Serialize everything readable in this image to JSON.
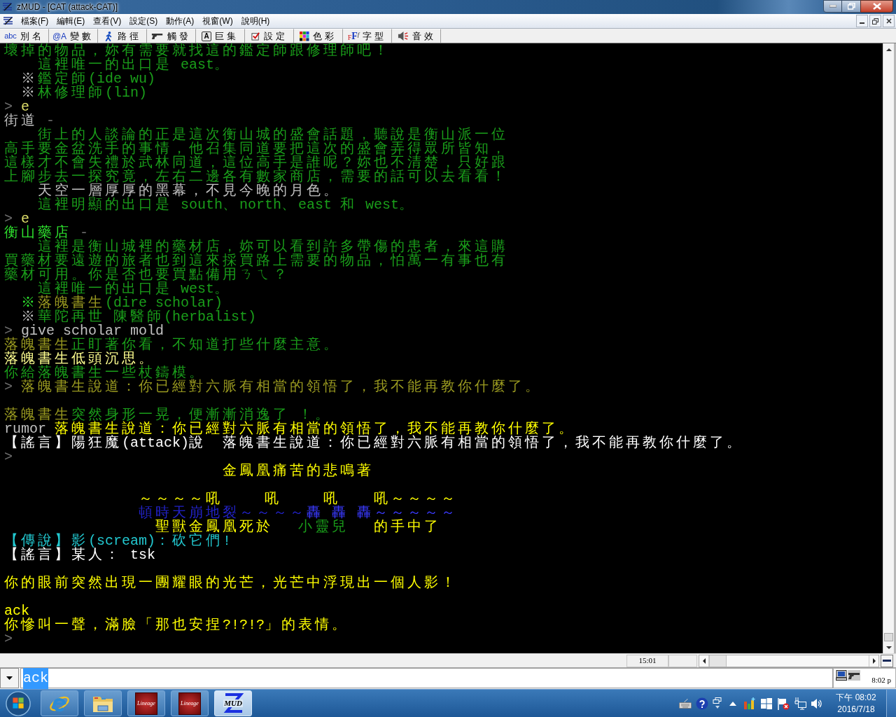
{
  "window": {
    "title": "zMUD - [CAT (attack-CAT)]"
  },
  "menu": [
    "檔案(F)",
    "編輯(E)",
    "查看(V)",
    "設定(S)",
    "動作(A)",
    "視窗(W)",
    "說明(H)"
  ],
  "toolbar": [
    {
      "kind": "alias",
      "icon_text": "abc",
      "label": "別名"
    },
    {
      "kind": "variable",
      "icon_text": "@A",
      "label": "變數"
    },
    {
      "kind": "path",
      "label": "路徑"
    },
    {
      "kind": "trigger",
      "label": "觸發"
    },
    {
      "kind": "macro",
      "icon_text": "A",
      "label": "巨集"
    },
    {
      "kind": "settings",
      "label": "設定"
    },
    {
      "kind": "colors",
      "label": "色彩"
    },
    {
      "kind": "font",
      "icon_text": "FFf",
      "label": "字型"
    },
    {
      "kind": "sound",
      "label": "音效"
    }
  ],
  "terminal": {
    "lines": [
      {
        "kind": "text",
        "segments": [
          {
            "text": "壞掉的物品，妳有需要就找這的鑑定師跟修理師吧！",
            "color": "#1a9e1a"
          }
        ]
      },
      {
        "kind": "text",
        "segments": [
          {
            "text": "    這裡唯一的出口是 east。",
            "color": "#1a9e1a"
          }
        ]
      },
      {
        "kind": "text",
        "segments": [
          {
            "text": "  ※",
            "color": "#c0c0c0"
          },
          {
            "text": "鑑定師(ide wu)",
            "color": "#1a9e1a"
          }
        ]
      },
      {
        "kind": "text",
        "segments": [
          {
            "text": "  ※",
            "color": "#c0c0c0"
          },
          {
            "text": "林修理師(lin)",
            "color": "#1a9e1a"
          }
        ]
      },
      {
        "kind": "text",
        "segments": [
          {
            "text": ">",
            "color": "#6e6e6e"
          },
          {
            "text": " e",
            "color": "#dede6a"
          }
        ]
      },
      {
        "kind": "text",
        "segments": [
          {
            "text": "街道",
            "color": "#c0c0c0"
          },
          {
            "text": " -",
            "color": "#6e6e6e"
          }
        ]
      },
      {
        "kind": "text",
        "segments": [
          {
            "text": "    街上的人談論的正是這次衡山城的盛會話題，聽說是衡山派一位",
            "color": "#1a9e1a"
          }
        ]
      },
      {
        "kind": "text",
        "segments": [
          {
            "text": "高手要金盆洗手的事情，他召集同道要把這次的盛會弄得眾所皆知，",
            "color": "#1a9e1a"
          }
        ]
      },
      {
        "kind": "text",
        "segments": [
          {
            "text": "這樣才不會失禮於武林同道，這位高手是誰呢？妳也不清楚，只好跟",
            "color": "#1a9e1a"
          }
        ]
      },
      {
        "kind": "text",
        "segments": [
          {
            "text": "上腳步去一探究竟，左右二邊各有數家商店，需要的話可以去看看！",
            "color": "#1a9e1a"
          }
        ]
      },
      {
        "kind": "text",
        "segments": [
          {
            "text": "    天空一層厚厚的黑幕，不見今晚的月色。",
            "color": "#c0c0c0"
          }
        ]
      },
      {
        "kind": "text",
        "segments": [
          {
            "text": "    這裡明顯的出口是 south、north、east 和 west。",
            "color": "#1a9e1a"
          }
        ]
      },
      {
        "kind": "text",
        "segments": [
          {
            "text": ">",
            "color": "#6e6e6e"
          },
          {
            "text": " e",
            "color": "#dede6a"
          }
        ]
      },
      {
        "kind": "text",
        "segments": [
          {
            "text": "衡山藥店",
            "color": "#2ee02e"
          },
          {
            "text": " -",
            "color": "#6e6e6e"
          }
        ]
      },
      {
        "kind": "text",
        "segments": [
          {
            "text": "    這裡是衡山城裡的藥材店，妳可以看到許多帶傷的患者，來這購",
            "color": "#1a9e1a"
          }
        ]
      },
      {
        "kind": "text",
        "segments": [
          {
            "text": "買藥材要遠遊的旅者也到這來採買路上需要的物品，怕萬一有事也有",
            "color": "#1a9e1a"
          }
        ]
      },
      {
        "kind": "text",
        "segments": [
          {
            "text": "藥材可用。你是否也要買點備用ㄋㄟ？",
            "color": "#1a9e1a"
          }
        ]
      },
      {
        "kind": "text",
        "segments": [
          {
            "text": "    這裡唯一的出口是 west。",
            "color": "#1a9e1a"
          }
        ]
      },
      {
        "kind": "text",
        "segments": [
          {
            "text": "  ※",
            "color": "#2ee02e"
          },
          {
            "text": "落魄書生",
            "color": "#9a9a20"
          },
          {
            "text": "(dire scholar)",
            "color": "#1a9e1a"
          }
        ]
      },
      {
        "kind": "text",
        "segments": [
          {
            "text": "  ※",
            "color": "#c0c0c0"
          },
          {
            "text": "華陀再世 陳醫師(herbalist)",
            "color": "#1a9e1a"
          }
        ]
      },
      {
        "kind": "text",
        "segments": [
          {
            "text": ">",
            "color": "#6e6e6e"
          },
          {
            "text": " give scholar mold",
            "color": "#c0c0c0"
          }
        ]
      },
      {
        "kind": "text",
        "segments": [
          {
            "text": "落魄書生",
            "color": "#9a9a20"
          },
          {
            "text": "正盯著你看，不知道打些什麼主意。",
            "color": "#1a9e1a"
          }
        ]
      },
      {
        "kind": "text",
        "segments": [
          {
            "text": "落魄書生低頭沉思。",
            "color": "#ffff90"
          }
        ]
      },
      {
        "kind": "text",
        "segments": [
          {
            "text": "你給落魄書生一些杖鑄模。",
            "color": "#1a9e1a"
          }
        ]
      },
      {
        "kind": "text",
        "segments": [
          {
            "text": ">",
            "color": "#6e6e6e"
          },
          {
            "text": " 落魄書生說道：你已經對六脈有相當的領悟了，我不能再教你什麼了。",
            "color": "#9a9a20"
          }
        ]
      },
      {
        "kind": "blank"
      },
      {
        "kind": "text",
        "segments": [
          {
            "text": "落魄書生",
            "color": "#9a9a20"
          },
          {
            "text": "突然身形一晃，便漸漸消逸了 ！。",
            "color": "#1a9e1a"
          }
        ]
      },
      {
        "kind": "text",
        "segments": [
          {
            "text": "rumor",
            "color": "#c0c0c0"
          },
          {
            "text": " 落魄書生說道：你已經對六脈有相當的領悟了，我不能再教你什麼了。",
            "color": "#ffff00"
          }
        ]
      },
      {
        "kind": "text",
        "segments": [
          {
            "text": "【謠言】陽狂魔(attack)說  落魄書生說道：你已經對六脈有相當的領悟了，我不能再教你什麼了。",
            "color": "#ffffff"
          }
        ]
      },
      {
        "kind": "text",
        "segments": [
          {
            "text": ">",
            "color": "#6e6e6e"
          }
        ]
      },
      {
        "kind": "text",
        "segments": [
          {
            "text": "                          金鳳凰痛苦的悲鳴著",
            "color": "#ffff00"
          }
        ]
      },
      {
        "kind": "blank"
      },
      {
        "kind": "text",
        "segments": [
          {
            "text": "                ～～～～吼     吼     吼    吼～～～～",
            "color": "#ffff00"
          }
        ]
      },
      {
        "kind": "text",
        "segments": [
          {
            "text": "                頓時天崩地裂～～～～",
            "color": "#2222c8"
          },
          {
            "text": "轟 轟 轟～～～～～",
            "color": "#3a3aff"
          }
        ]
      },
      {
        "kind": "text",
        "segments": [
          {
            "text": "                  聖獸金鳳凰死於",
            "color": "#ffff00"
          },
          {
            "text": "   小靈兒",
            "color": "#1a9e1a"
          },
          {
            "text": "   的手中了",
            "color": "#ffff00"
          }
        ]
      },
      {
        "kind": "text",
        "segments": [
          {
            "text": "【傳說】影(scream)：砍它們!",
            "color": "#22c8d0"
          }
        ]
      },
      {
        "kind": "text",
        "segments": [
          {
            "text": "【謠言】某人： tsk",
            "color": "#ffffff"
          }
        ]
      },
      {
        "kind": "blank"
      },
      {
        "kind": "text",
        "segments": [
          {
            "text": "你的眼前突然出現一團耀眼的光芒，光芒中浮現出一個人影！",
            "color": "#ffff00"
          }
        ]
      },
      {
        "kind": "blank"
      },
      {
        "kind": "text",
        "segments": [
          {
            "text": "ack",
            "color": "#ffff00"
          }
        ]
      },
      {
        "kind": "text",
        "segments": [
          {
            "text": "你慘叫一聲，滿臉「那也安捏?!?!?」的表情。",
            "color": "#ffff00"
          }
        ]
      },
      {
        "kind": "text",
        "segments": [
          {
            "text": ">",
            "color": "#6e6e6e"
          }
        ]
      }
    ]
  },
  "status_bar": {
    "time": "15:01"
  },
  "command": {
    "value": "ack",
    "highlighted": true,
    "clock": "8:02 p"
  },
  "taskbar": {
    "apps": [
      {
        "kind": "browser",
        "selected": false
      },
      {
        "kind": "folder",
        "selected": false
      },
      {
        "kind": "game",
        "icon_text": "Lineage",
        "selected": false
      },
      {
        "kind": "game",
        "icon_text": "Lineage",
        "selected": false
      },
      {
        "kind": "mud",
        "icon_text": "MUD",
        "selected": true
      }
    ],
    "time": "下午 08:02",
    "date": "2016/7/18"
  }
}
